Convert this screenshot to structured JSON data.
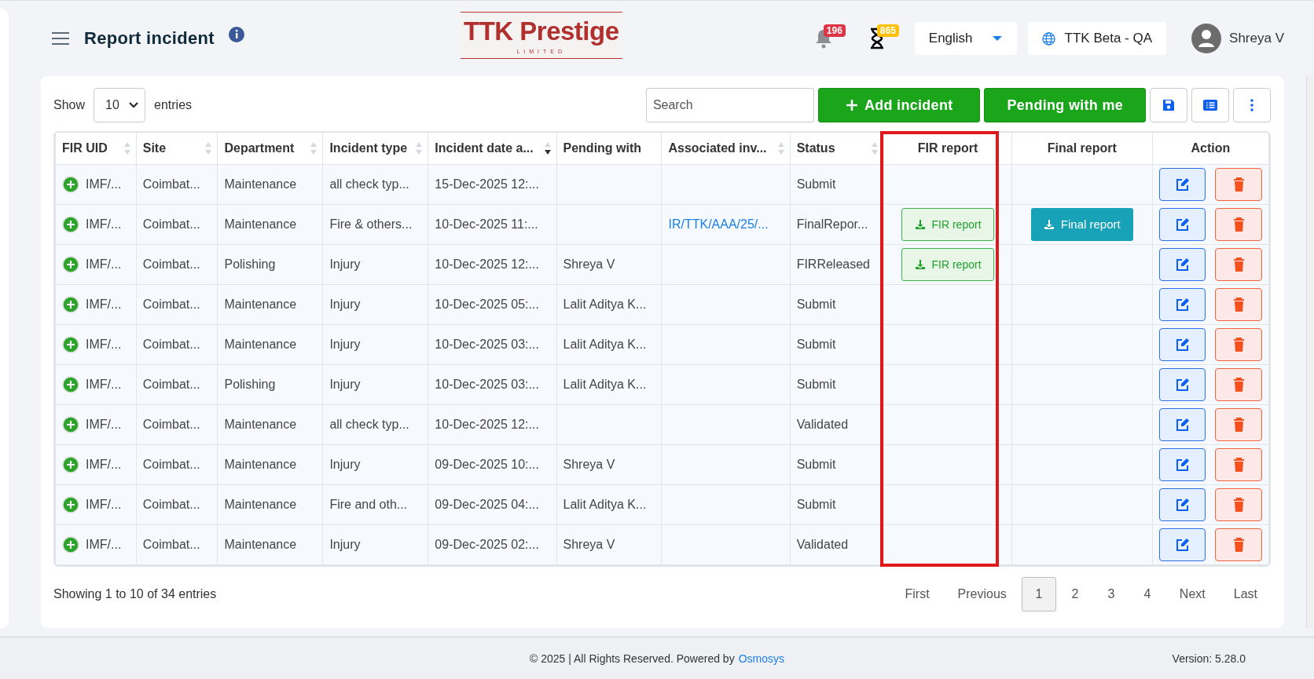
{
  "header": {
    "title": "Report incident",
    "notifications": "196",
    "tasks": "865",
    "language": "English",
    "environment": "TTK Beta - QA",
    "user": "Shreya V"
  },
  "logo": {
    "name": "TTK Prestige",
    "subtitle": "LIMITED"
  },
  "toolbar": {
    "show_label": "Show",
    "page_size": "10",
    "entries_label": "entries",
    "search_placeholder": "Search",
    "add_button": "Add incident",
    "pending_button": "Pending with me"
  },
  "table": {
    "columns": [
      {
        "label": "FIR UID",
        "sortable": true,
        "sorted": false,
        "highlighted": false
      },
      {
        "label": "Site",
        "sortable": true,
        "sorted": false,
        "highlighted": false
      },
      {
        "label": "Department",
        "sortable": true,
        "sorted": false,
        "highlighted": false
      },
      {
        "label": "Incident type",
        "sortable": true,
        "sorted": false,
        "highlighted": false
      },
      {
        "label": "Incident date a...",
        "sortable": true,
        "sorted": true,
        "highlighted": false
      },
      {
        "label": "Pending with",
        "sortable": false,
        "highlighted": false
      },
      {
        "label": "Associated inv...",
        "sortable": true,
        "sorted": false,
        "highlighted": false
      },
      {
        "label": "Status",
        "sortable": true,
        "sorted": false,
        "highlighted": false
      },
      {
        "label": "FIR report",
        "sortable": false,
        "highlighted": true
      },
      {
        "label": "Final report",
        "sortable": false,
        "highlighted": false
      },
      {
        "label": "Action",
        "sortable": false,
        "highlighted": false
      }
    ],
    "rows": [
      {
        "uid": "IMF/...",
        "site": "Coimbat...",
        "department": "Maintenance",
        "type": "all check typ...",
        "date": "15-Dec-2025 12:...",
        "pending": "",
        "associated": "",
        "status": "Submit"
      },
      {
        "uid": "IMF/...",
        "site": "Coimbat...",
        "department": "Maintenance",
        "type": "Fire & others...",
        "date": "10-Dec-2025 11:...",
        "pending": "",
        "associated": "IR/TTK/AAA/25/...",
        "status": "FinalRepor...",
        "fir_report": "FIR report",
        "final_report": "Final report"
      },
      {
        "uid": "IMF/...",
        "site": "Coimbat...",
        "department": "Polishing",
        "type": "Injury",
        "date": "10-Dec-2025 12:...",
        "pending": "Shreya V",
        "associated": "",
        "status": "FIRReleased",
        "fir_report": "FIR report"
      },
      {
        "uid": "IMF/...",
        "site": "Coimbat...",
        "department": "Maintenance",
        "type": "Injury",
        "date": "10-Dec-2025 05:...",
        "pending": "Lalit Aditya K...",
        "associated": "",
        "status": "Submit"
      },
      {
        "uid": "IMF/...",
        "site": "Coimbat...",
        "department": "Maintenance",
        "type": "Injury",
        "date": "10-Dec-2025 03:...",
        "pending": "Lalit Aditya K...",
        "associated": "",
        "status": "Submit"
      },
      {
        "uid": "IMF/...",
        "site": "Coimbat...",
        "department": "Polishing",
        "type": "Injury",
        "date": "10-Dec-2025 03:...",
        "pending": "Lalit Aditya K...",
        "associated": "",
        "status": "Submit"
      },
      {
        "uid": "IMF/...",
        "site": "Coimbat...",
        "department": "Maintenance",
        "type": "all check typ...",
        "date": "10-Dec-2025 12:...",
        "pending": "",
        "associated": "",
        "status": "Validated"
      },
      {
        "uid": "IMF/...",
        "site": "Coimbat...",
        "department": "Maintenance",
        "type": "Injury",
        "date": "09-Dec-2025 10:...",
        "pending": "Shreya V",
        "associated": "",
        "status": "Submit"
      },
      {
        "uid": "IMF/...",
        "site": "Coimbat...",
        "department": "Maintenance",
        "type": "Fire and oth...",
        "date": "09-Dec-2025 04:...",
        "pending": "Lalit Aditya K...",
        "associated": "",
        "status": "Submit"
      },
      {
        "uid": "IMF/...",
        "site": "Coimbat...",
        "department": "Maintenance",
        "type": "Injury",
        "date": "09-Dec-2025 02:...",
        "pending": "Shreya V",
        "associated": "",
        "status": "Validated"
      }
    ]
  },
  "summary": "Showing 1 to 10 of 34 entries",
  "pagination": [
    {
      "label": "First",
      "selected": false
    },
    {
      "label": "Previous",
      "selected": false
    },
    {
      "label": "1",
      "selected": true
    },
    {
      "label": "2",
      "selected": false
    },
    {
      "label": "3",
      "selected": false
    },
    {
      "label": "4",
      "selected": false
    },
    {
      "label": "Next",
      "selected": false
    },
    {
      "label": "Last",
      "selected": false
    }
  ],
  "footer": {
    "copyright": "© 2025 | All Rights Reserved. Powered by",
    "link": "Osmosys",
    "version": "Version: 5.28.0"
  }
}
